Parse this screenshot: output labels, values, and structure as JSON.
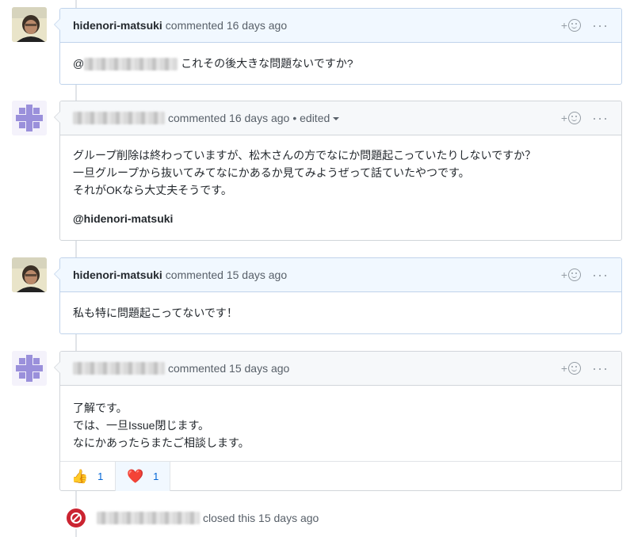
{
  "comments": [
    {
      "author": "hidenori-matsuki",
      "meta": "commented 16 days ago",
      "body": [
        "これその後大きな問題ないですか?"
      ],
      "mention_prefix": "@"
    },
    {
      "author": "",
      "meta": "commented 16 days ago",
      "edited": "• edited",
      "body": [
        "グループ削除は終わっていますが、松木さんの方でなにか問題起こっていたりしないですか？",
        "一旦グループから抜いてみてなにかあるか見てみようぜって話ていたやつです。",
        "それがOKなら大丈夫そうです。"
      ],
      "mention": "@hidenori-matsuki"
    },
    {
      "author": "hidenori-matsuki",
      "meta": "commented 15 days ago",
      "body": [
        "私も特に問題起こってないです！"
      ]
    },
    {
      "author": "",
      "meta": "commented 15 days ago",
      "body": [
        "了解です。",
        "では、一旦Issue閉じます。",
        "なにかあったらまたご相談します。"
      ],
      "reactions": [
        {
          "emoji": "👍",
          "count": "1"
        },
        {
          "emoji": "❤️",
          "count": "1"
        }
      ]
    }
  ],
  "header_actions": {
    "add_reaction": "+",
    "more": "···"
  },
  "closed_event": {
    "text": "closed this 15 days ago"
  },
  "colors": {
    "closed": "#cb2431",
    "link": "#0366d6",
    "own_header": "#f1f8ff"
  }
}
